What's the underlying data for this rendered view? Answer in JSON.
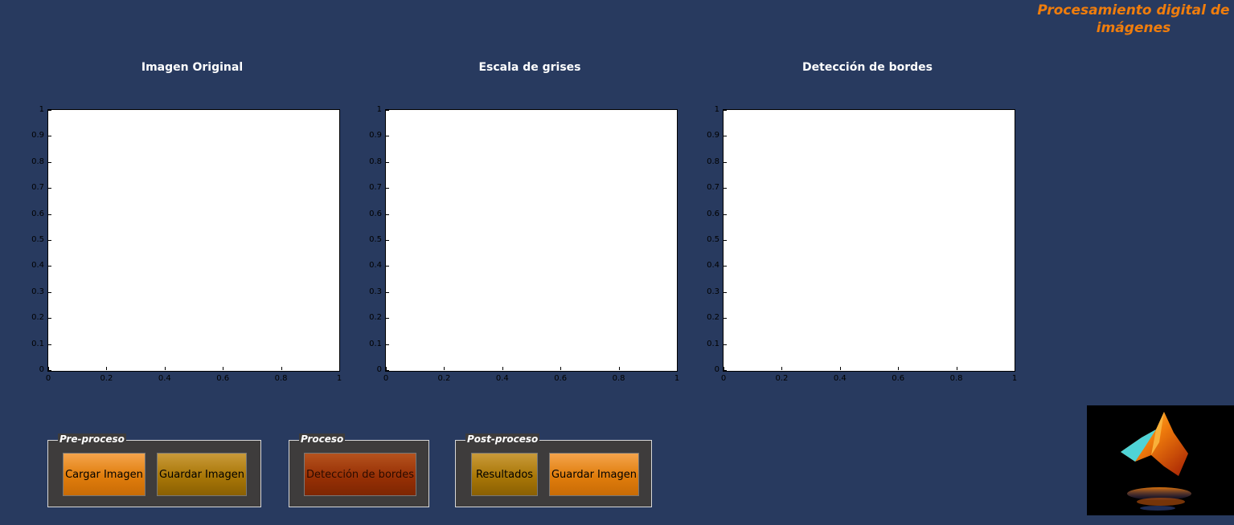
{
  "app_title": {
    "line1": "Procesamiento digital de",
    "line2": "imágenes"
  },
  "axes": [
    {
      "title": "Imagen Original"
    },
    {
      "title": "Escala de grises"
    },
    {
      "title": "Detección de bordes"
    }
  ],
  "axis_ticks": {
    "x": [
      "0",
      "0.2",
      "0.4",
      "0.6",
      "0.8",
      "1"
    ],
    "y": [
      "1",
      "0.9",
      "0.8",
      "0.7",
      "0.6",
      "0.5",
      "0.4",
      "0.3",
      "0.2",
      "0.1",
      "0"
    ]
  },
  "panels": {
    "preproceso": {
      "title": "Pre-proceso",
      "buttons": [
        "Cargar Imagen",
        "Guardar Imagen"
      ]
    },
    "proceso": {
      "title": "Proceso",
      "buttons": [
        "Detección de bordes"
      ]
    },
    "postproceso": {
      "title": "Post-proceso",
      "buttons": [
        "Resultados",
        "Guardar Imagen"
      ]
    }
  },
  "logo": {
    "icon": "matlab-logo-icon"
  },
  "colors": {
    "background": "#283a5f",
    "title": "#f07d0c",
    "button_orange": "#e07d0c",
    "button_olive": "#a97707",
    "button_rust": "#983005",
    "panel": "#3e3c3c"
  }
}
